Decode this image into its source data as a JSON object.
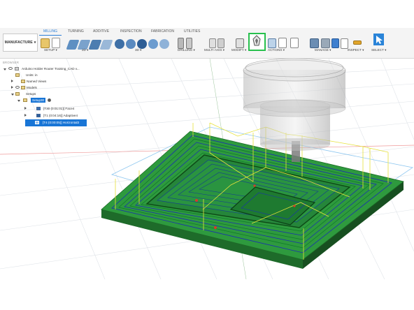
{
  "app": {
    "workspace_label": "MANUFACTURE"
  },
  "tabs": [
    "MILLING",
    "TURNING",
    "ADDITIVE",
    "INSPECTION",
    "FABRICATION",
    "UTILITIES"
  ],
  "groups": {
    "setup": "SETUP ▾",
    "two_d": "2D ▾",
    "three_d": "3D ▾",
    "drilling": "DRILLING ▾",
    "multi_axis": "MULTI-AXIS ▾",
    "modify": "MODIFY ▾",
    "actions": "ACTIONS ▾",
    "manage": "MANAGE ▾",
    "inspect": "INSPECT ▾",
    "select": "SELECT ▾"
  },
  "browser": {
    "header": "BROWSER",
    "document": "Arduino Holder Router Training_CAD v...",
    "units": "Units: in",
    "named_views": "Named Views",
    "models": "Models",
    "setups": "Setups",
    "setup_name": "Setup30",
    "operations": [
      "[T30 (0:01:01)] Face4",
      "[T1 (0:04:16)] Adaptive4",
      "[T4 (0:00:05)] Horizontal3"
    ]
  },
  "colors": {
    "accent": "#2b7fd8",
    "highlight": "#27c04d",
    "stock": "#2e8f3e",
    "toolpath": "#1a2fb0",
    "rapid": "#e6e23b"
  }
}
